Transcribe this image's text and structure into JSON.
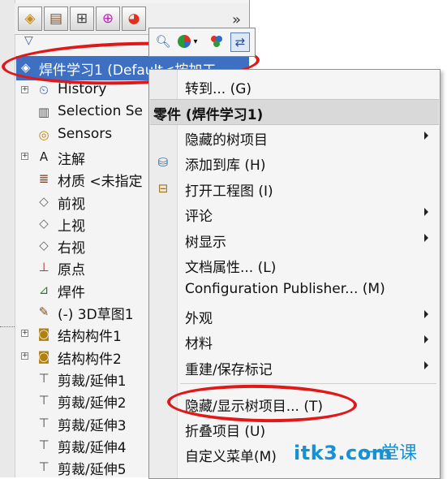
{
  "feature_tree": {
    "root_label": "焊件学习1  (Default<按加工",
    "items": [
      {
        "label": "History",
        "expandable": true,
        "icon": "history-icon"
      },
      {
        "label": "Selection Se",
        "expandable": false,
        "icon": "selection-sets-icon"
      },
      {
        "label": "Sensors",
        "expandable": false,
        "icon": "sensors-icon"
      },
      {
        "label": "注解",
        "expandable": true,
        "icon": "annotations-icon"
      },
      {
        "label": "材质 <未指定",
        "expandable": false,
        "icon": "material-icon"
      },
      {
        "label": "前视",
        "expandable": false,
        "icon": "plane-icon"
      },
      {
        "label": "上视",
        "expandable": false,
        "icon": "plane-icon"
      },
      {
        "label": "右视",
        "expandable": false,
        "icon": "plane-icon"
      },
      {
        "label": "原点",
        "expandable": false,
        "icon": "origin-icon"
      },
      {
        "label": "焊件",
        "expandable": false,
        "icon": "weldment-icon"
      },
      {
        "label": "(-) 3D草图1",
        "expandable": false,
        "icon": "3d-sketch-icon"
      },
      {
        "label": "结构构件1",
        "expandable": true,
        "icon": "structural-member-icon"
      },
      {
        "label": "结构构件2",
        "expandable": true,
        "icon": "structural-member-icon"
      },
      {
        "label": "剪裁/延伸1",
        "expandable": false,
        "icon": "trim-extend-icon"
      },
      {
        "label": "剪裁/延伸2",
        "expandable": false,
        "icon": "trim-extend-icon"
      },
      {
        "label": "剪裁/延伸3",
        "expandable": false,
        "icon": "trim-extend-icon"
      },
      {
        "label": "剪裁/延伸4",
        "expandable": false,
        "icon": "trim-extend-icon"
      },
      {
        "label": "剪裁/延伸5",
        "expandable": false,
        "icon": "trim-extend-icon"
      }
    ],
    "more_tabs": "»"
  },
  "context_menu": {
    "goto": "转到... (G)",
    "header": "零件 (焊件学习1)",
    "items": [
      {
        "label": "隐藏的树项目",
        "submenu": true,
        "icon": ""
      },
      {
        "label": "添加到库 (H)",
        "submenu": false,
        "icon": "add-to-library-icon"
      },
      {
        "label": "打开工程图 (I)",
        "submenu": false,
        "icon": "open-drawing-icon"
      },
      {
        "label": "评论",
        "submenu": true,
        "icon": ""
      },
      {
        "label": "树显示",
        "submenu": true,
        "icon": ""
      },
      {
        "label": "文档属性... (L)",
        "submenu": false,
        "icon": ""
      },
      {
        "label": "Configuration Publisher... (M)",
        "submenu": false,
        "icon": ""
      },
      {
        "label": "外观",
        "submenu": true,
        "icon": ""
      },
      {
        "label": "材料",
        "submenu": true,
        "icon": ""
      },
      {
        "label": "重建/保存标记",
        "submenu": true,
        "icon": ""
      }
    ],
    "bottom_items": [
      {
        "label": "隐藏/显示树项目... (T)"
      },
      {
        "label": "折叠项目 (U)"
      },
      {
        "label": "自定义菜单(M)"
      }
    ]
  },
  "watermark": {
    "text": "itk3.com",
    "cn": "一堂课"
  },
  "colors": {
    "selection": "#3d6fc2",
    "annotation_red": "#e01818",
    "watermark": "#1591d6"
  }
}
